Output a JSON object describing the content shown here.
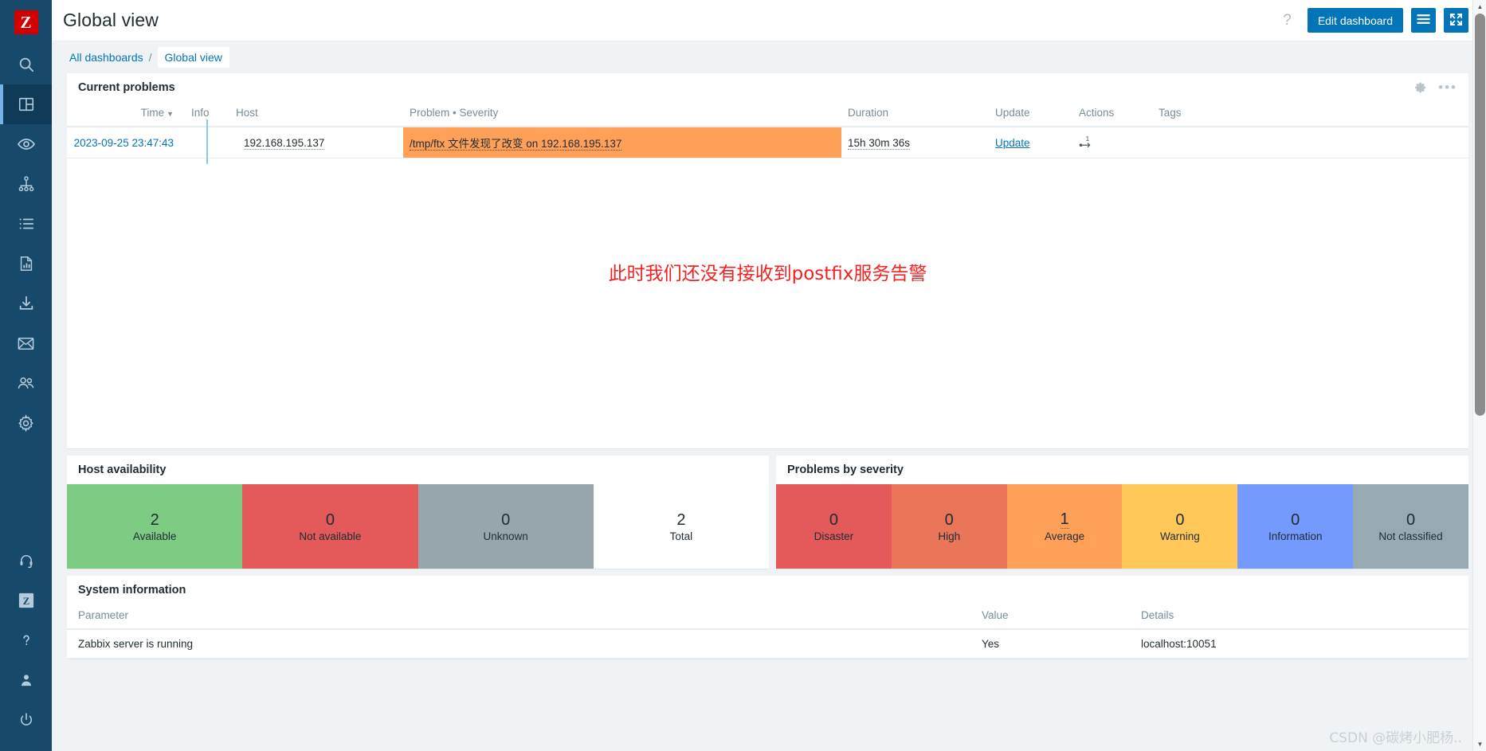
{
  "app": {
    "logo_letter": "Z",
    "page_title": "Global view"
  },
  "sidebar": {
    "items": [
      {
        "name": "search",
        "icon": "search-icon"
      },
      {
        "name": "dashboards",
        "icon": "dashboard-icon",
        "active": true
      },
      {
        "name": "monitoring",
        "icon": "eye-icon"
      },
      {
        "name": "services",
        "icon": "sitemap-icon"
      },
      {
        "name": "inventory",
        "icon": "list-icon"
      },
      {
        "name": "reports",
        "icon": "report-chart-icon"
      },
      {
        "name": "data-collection",
        "icon": "download-icon"
      },
      {
        "name": "alerts",
        "icon": "envelope-icon"
      },
      {
        "name": "users",
        "icon": "users-icon"
      },
      {
        "name": "administration",
        "icon": "gear-icon"
      }
    ],
    "bottom_items": [
      {
        "name": "support",
        "icon": "headset-icon"
      },
      {
        "name": "integrations",
        "icon": "zabbix-z-icon"
      },
      {
        "name": "help",
        "icon": "question-icon"
      },
      {
        "name": "user-settings",
        "icon": "person-icon"
      },
      {
        "name": "sign-out",
        "icon": "power-icon"
      }
    ]
  },
  "topbar": {
    "help_glyph": "?",
    "edit_dashboard_label": "Edit dashboard",
    "menu_icon": "hamburger-icon",
    "fullscreen_icon": "expand-icon"
  },
  "breadcrumb": {
    "all_dashboards": "All dashboards",
    "separator": "/",
    "current": "Global view"
  },
  "current_problems": {
    "title": "Current problems",
    "gear_icon": "gear-icon",
    "more_icon": "ellipsis-icon",
    "columns": [
      "Time",
      "Info",
      "Host",
      "Problem • Severity",
      "Duration",
      "Update",
      "Actions",
      "Tags"
    ],
    "sort_arrow": "▼",
    "rows": [
      {
        "time": "2023-09-25 23:47:43",
        "info": "info-dot",
        "host": "192.168.195.137",
        "problem": "/tmp/ftx 文件发现了改变 on 192.168.195.137",
        "severity": "Average",
        "duration": "15h 30m 36s",
        "update": "Update",
        "actions": "1",
        "tags": ""
      }
    ],
    "annotation": "此时我们还没有接收到postfix服务告警",
    "annotation_color": "#f42121"
  },
  "host_availability": {
    "title": "Host availability",
    "blocks": [
      {
        "value": "2",
        "label": "Available",
        "color": "#7ecb83"
      },
      {
        "value": "0",
        "label": "Not available",
        "color": "#e45959"
      },
      {
        "value": "0",
        "label": "Unknown",
        "color": "#97a5ad"
      },
      {
        "value": "2",
        "label": "Total",
        "color": "#ffffff"
      }
    ]
  },
  "problems_by_severity": {
    "title": "Problems by severity",
    "blocks": [
      {
        "value": "0",
        "label": "Disaster",
        "color": "#e45959",
        "emphasis": false
      },
      {
        "value": "0",
        "label": "High",
        "color": "#e97659",
        "emphasis": false
      },
      {
        "value": "1",
        "label": "Average",
        "color": "#ffa059",
        "emphasis": true
      },
      {
        "value": "0",
        "label": "Warning",
        "color": "#ffc859",
        "emphasis": false
      },
      {
        "value": "0",
        "label": "Information",
        "color": "#7499ff",
        "emphasis": false
      },
      {
        "value": "0",
        "label": "Not classified",
        "color": "#97aab3",
        "emphasis": false
      }
    ]
  },
  "system_information": {
    "title": "System information",
    "columns": [
      "Parameter",
      "Value",
      "Details"
    ],
    "rows": [
      {
        "parameter": "Zabbix server is running",
        "value": "Yes",
        "details": "localhost:10051"
      }
    ]
  },
  "watermark": "CSDN @碳烤小肥杨.."
}
